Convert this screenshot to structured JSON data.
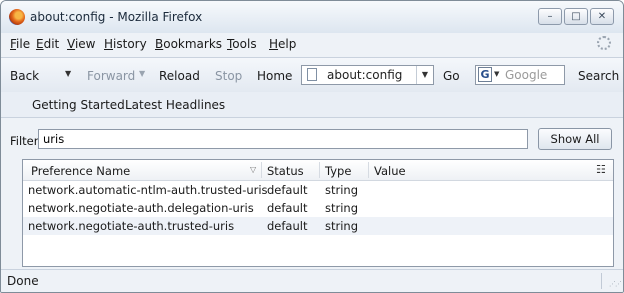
{
  "window": {
    "title": "about:config - Mozilla Firefox"
  },
  "window_controls": {
    "minimize": "–",
    "maximize": "□",
    "close": "✕"
  },
  "menubar": {
    "items": [
      "File",
      "Edit",
      "View",
      "History",
      "Bookmarks",
      "Tools",
      "Help"
    ]
  },
  "toolbar": {
    "back": "Back",
    "forward": "Forward",
    "reload": "Reload",
    "stop": "Stop",
    "home": "Home",
    "url": "about:config",
    "go": "Go",
    "search_placeholder": "Google",
    "search_button": "Search",
    "dropdown_arrow": "▼",
    "search_engine_letter": "G"
  },
  "bookmarks": {
    "items": [
      "Getting Started",
      "Latest Headlines"
    ]
  },
  "filter": {
    "label": "Filter:",
    "value": "uris",
    "show_all": "Show All"
  },
  "table": {
    "columns": [
      "Preference Name",
      "Status",
      "Type",
      "Value"
    ],
    "rows": [
      {
        "name": "network.automatic-ntlm-auth.trusted-uris",
        "status": "default",
        "type": "string",
        "value": ""
      },
      {
        "name": "network.negotiate-auth.delegation-uris",
        "status": "default",
        "type": "string",
        "value": ""
      },
      {
        "name": "network.negotiate-auth.trusted-uris",
        "status": "default",
        "type": "string",
        "value": ""
      }
    ]
  },
  "status_bar": {
    "text": "Done"
  },
  "icons": {
    "app": "firefox-logo-icon",
    "throbber": "throbber-icon",
    "page": "page-icon",
    "search_engine": "google-icon",
    "column_picker": "column-picker-icon",
    "sort": "sort-indicator-icon",
    "resize": "resize-grip-icon"
  }
}
